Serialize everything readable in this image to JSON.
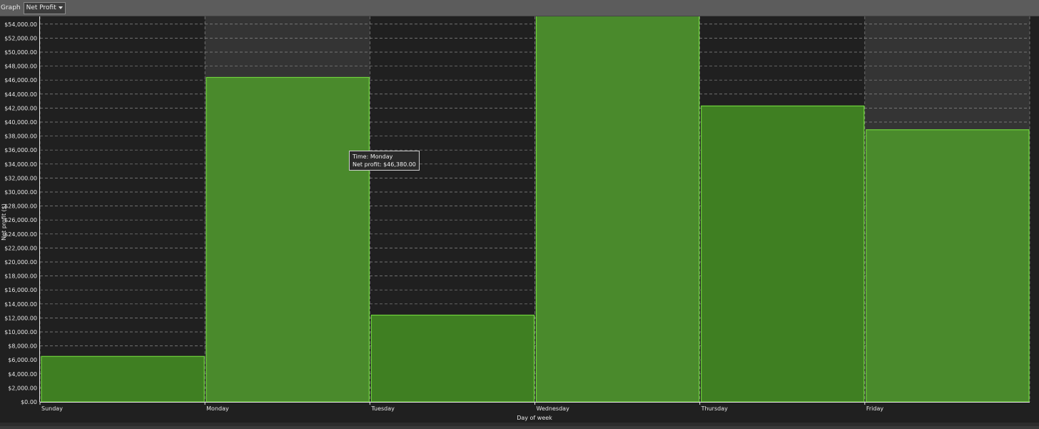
{
  "toolbar": {
    "graph_label": "Graph",
    "graph_selected": "Net Profit"
  },
  "chart_data": {
    "type": "bar",
    "xlabel": "Day of week",
    "ylabel": "Net profit ($)",
    "categories": [
      "Sunday",
      "Monday",
      "Tuesday",
      "Wednesday",
      "Thursday",
      "Friday"
    ],
    "values": [
      6500,
      46380,
      12400,
      55700,
      42300,
      38900
    ],
    "ylim": [
      0,
      54000
    ],
    "yticks": [
      "$0.00",
      "$2,000.00",
      "$4,000.00",
      "$6,000.00",
      "$8,000.00",
      "$10,000.00",
      "$12,000.00",
      "$14,000.00",
      "$16,000.00",
      "$18,000.00",
      "$20,000.00",
      "$22,000.00",
      "$24,000.00",
      "$26,000.00",
      "$28,000.00",
      "$30,000.00",
      "$32,000.00",
      "$34,000.00",
      "$36,000.00",
      "$38,000.00",
      "$40,000.00",
      "$42,000.00",
      "$44,000.00",
      "$46,000.00",
      "$48,000.00",
      "$50,000.00",
      "$52,000.00",
      "$54,000.00"
    ],
    "grid": true,
    "highlighted_category": "Monday",
    "colors": {
      "bar_fill": "#3f7f22",
      "bar_fill_light": "#4a8a2c",
      "bar_border": "#6fd43b",
      "background": "#202020",
      "column_highlight": "#343434",
      "grid": "#8a8a8a"
    }
  },
  "tooltip": {
    "line1": "Time: Monday",
    "line2": "Net profit: $46,380.00"
  }
}
